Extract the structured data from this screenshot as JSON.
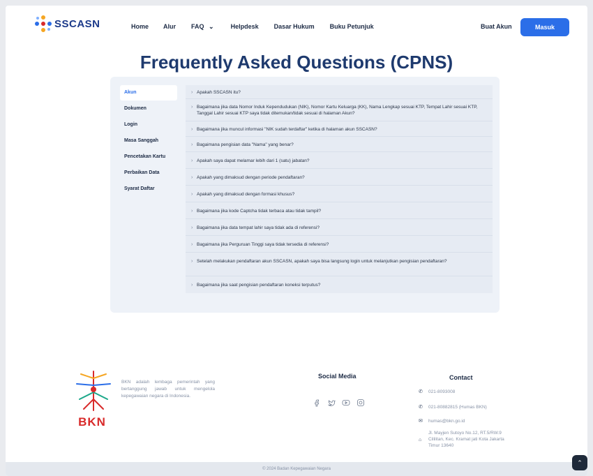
{
  "header": {
    "logo": "SSCASN",
    "nav": [
      "Home",
      "Alur",
      "FAQ",
      "Helpdesk",
      "Dasar Hukum",
      "Buku Petunjuk"
    ],
    "buat_akun": "Buat Akun",
    "masuk": "Masuk"
  },
  "title": "Frequently Asked Questions (CPNS)",
  "categories": [
    "Akun",
    "Dokumen",
    "Login",
    "Masa Sanggah",
    "Pencetakan Kartu",
    "Perbaikan Data",
    "Syarat Daftar"
  ],
  "questions": [
    "Apakah SSCASN itu?",
    "Bagaimana jika data Nomor Induk Kependudukan (NIK), Nomor Kartu Keluarga (KK), Nama Lengkap sesuai KTP, Tempat Lahir sesuai KTP, Tanggal Lahir sesuai KTP saya tidak ditemukan/tidak sesuai di halaman Akun?",
    "Bagaimana jika muncul informasi \"NIK sudah terdaftar\" ketika di halaman akun SSCASN?",
    "Bagaimana pengisian data \"Nama\" yang benar?",
    "Apakah saya dapat melamar lebih dari 1 (satu) jabatan?",
    "Apakah yang dimaksud dengan periode pendaftaran?",
    "Apakah yang dimaksud dengan formasi khusus?",
    "Bagaimana jika kode Captcha tidak terbaca atau tidak tampil?",
    "Bagaimana jika data tempat lahir saya tidak ada di referensi?",
    "Bagaimana jika Perguruan Tinggi saya tidak tersedia di referensi?",
    "Setelah melakukan pendaftaran akun SSCASN, apakah saya bisa langsung login untuk melanjutkan pengisian pendaftaran?",
    "Bagaimana jika saat pengisian pendaftaran koneksi terputus?"
  ],
  "footer": {
    "org": "BKN",
    "description": "BKN adalah lembaga pemerintah yang bertanggung jawab untuk mengelola kepegawaian negara di Indonesia.",
    "social_title": "Social Media",
    "contact_title": "Contact",
    "phone1": "021-8093008",
    "phone2": "021-80882815 (Humas BKN)",
    "email": "humas@bkn.go.id",
    "address": "Jl. Mayjen Sutoyo No.12, RT.5/RW.9 Cililitan, Kec. Kramat jati Kota Jakarta Timur 13640",
    "copyright": "© 2024 Badan Kepegawaian Negara"
  }
}
